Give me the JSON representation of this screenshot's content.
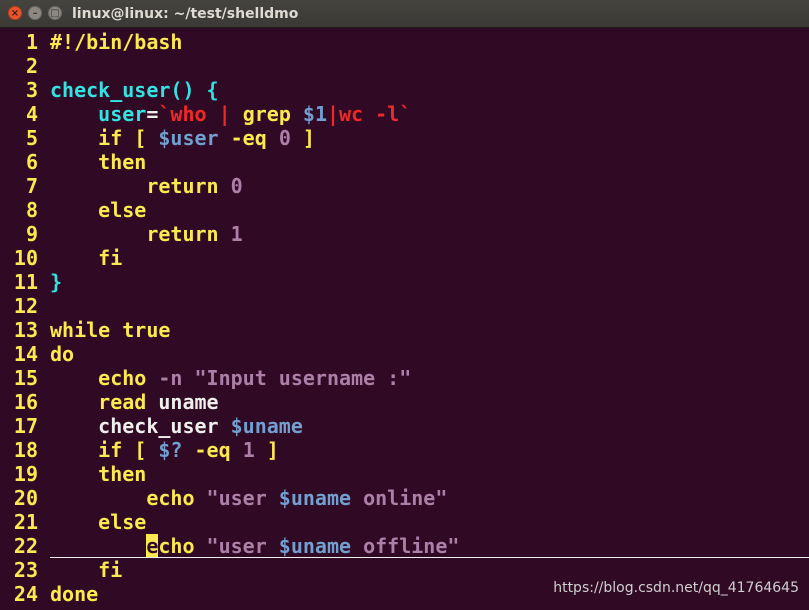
{
  "window": {
    "title": "linux@linux: ~/test/shelldmo",
    "close_glyph": "×",
    "min_glyph": "–",
    "max_glyph": "□"
  },
  "lines": [
    {
      "n": "1",
      "tokens": [
        {
          "t": "#!/bin/bash",
          "c": "kw"
        }
      ]
    },
    {
      "n": "2",
      "tokens": []
    },
    {
      "n": "3",
      "tokens": [
        {
          "t": "check_user() {",
          "c": "fn"
        }
      ]
    },
    {
      "n": "4",
      "tokens": [
        {
          "t": "    ",
          "c": "plain"
        },
        {
          "t": "user",
          "c": "id"
        },
        {
          "t": "=",
          "c": "plain"
        },
        {
          "t": "`who ",
          "c": "red"
        },
        {
          "t": "|",
          "c": "red"
        },
        {
          "t": " grep ",
          "c": "kw"
        },
        {
          "t": "$1",
          "c": "var"
        },
        {
          "t": "|",
          "c": "red"
        },
        {
          "t": "wc -l`",
          "c": "red"
        }
      ]
    },
    {
      "n": "5",
      "tokens": [
        {
          "t": "    if [ ",
          "c": "kw"
        },
        {
          "t": "$user",
          "c": "var"
        },
        {
          "t": " -eq ",
          "c": "kw"
        },
        {
          "t": "0",
          "c": "num"
        },
        {
          "t": " ]",
          "c": "kw"
        }
      ]
    },
    {
      "n": "6",
      "tokens": [
        {
          "t": "    then",
          "c": "kw"
        }
      ]
    },
    {
      "n": "7",
      "tokens": [
        {
          "t": "        return ",
          "c": "kw"
        },
        {
          "t": "0",
          "c": "num"
        }
      ]
    },
    {
      "n": "8",
      "tokens": [
        {
          "t": "    else",
          "c": "kw"
        }
      ]
    },
    {
      "n": "9",
      "tokens": [
        {
          "t": "        return ",
          "c": "kw"
        },
        {
          "t": "1",
          "c": "num"
        }
      ]
    },
    {
      "n": "10",
      "tokens": [
        {
          "t": "    fi",
          "c": "kw"
        }
      ]
    },
    {
      "n": "11",
      "tokens": [
        {
          "t": "}",
          "c": "fn"
        }
      ]
    },
    {
      "n": "12",
      "tokens": []
    },
    {
      "n": "13",
      "tokens": [
        {
          "t": "while true",
          "c": "kw"
        }
      ]
    },
    {
      "n": "14",
      "tokens": [
        {
          "t": "do",
          "c": "kw"
        }
      ]
    },
    {
      "n": "15",
      "tokens": [
        {
          "t": "    echo ",
          "c": "kw"
        },
        {
          "t": "-n ",
          "c": "num"
        },
        {
          "t": "\"Input username :\"",
          "c": "str"
        }
      ]
    },
    {
      "n": "16",
      "tokens": [
        {
          "t": "    read ",
          "c": "kw"
        },
        {
          "t": "uname",
          "c": "plain"
        }
      ]
    },
    {
      "n": "17",
      "tokens": [
        {
          "t": "    check_user ",
          "c": "plain"
        },
        {
          "t": "$uname",
          "c": "var"
        }
      ]
    },
    {
      "n": "18",
      "tokens": [
        {
          "t": "    if [ ",
          "c": "kw"
        },
        {
          "t": "$?",
          "c": "var"
        },
        {
          "t": " -eq ",
          "c": "kw"
        },
        {
          "t": "1",
          "c": "num"
        },
        {
          "t": " ]",
          "c": "kw"
        }
      ]
    },
    {
      "n": "19",
      "tokens": [
        {
          "t": "    then",
          "c": "kw"
        }
      ]
    },
    {
      "n": "20",
      "tokens": [
        {
          "t": "        echo ",
          "c": "kw"
        },
        {
          "t": "\"user ",
          "c": "str"
        },
        {
          "t": "$uname",
          "c": "var"
        },
        {
          "t": " online\"",
          "c": "str"
        }
      ]
    },
    {
      "n": "21",
      "tokens": [
        {
          "t": "    else",
          "c": "kw"
        }
      ]
    },
    {
      "n": "22",
      "cursorline": true,
      "tokens": [
        {
          "t": "        ",
          "c": "plain"
        },
        {
          "t": "e",
          "c": "cursor"
        },
        {
          "t": "cho ",
          "c": "kw"
        },
        {
          "t": "\"user ",
          "c": "str"
        },
        {
          "t": "$uname",
          "c": "var"
        },
        {
          "t": " offline\"",
          "c": "str"
        }
      ]
    },
    {
      "n": "23",
      "tokens": [
        {
          "t": "    fi",
          "c": "kw"
        }
      ]
    },
    {
      "n": "24",
      "tokens": [
        {
          "t": "done",
          "c": "kw"
        }
      ]
    }
  ],
  "watermark": "https://blog.csdn.net/qq_41764645"
}
